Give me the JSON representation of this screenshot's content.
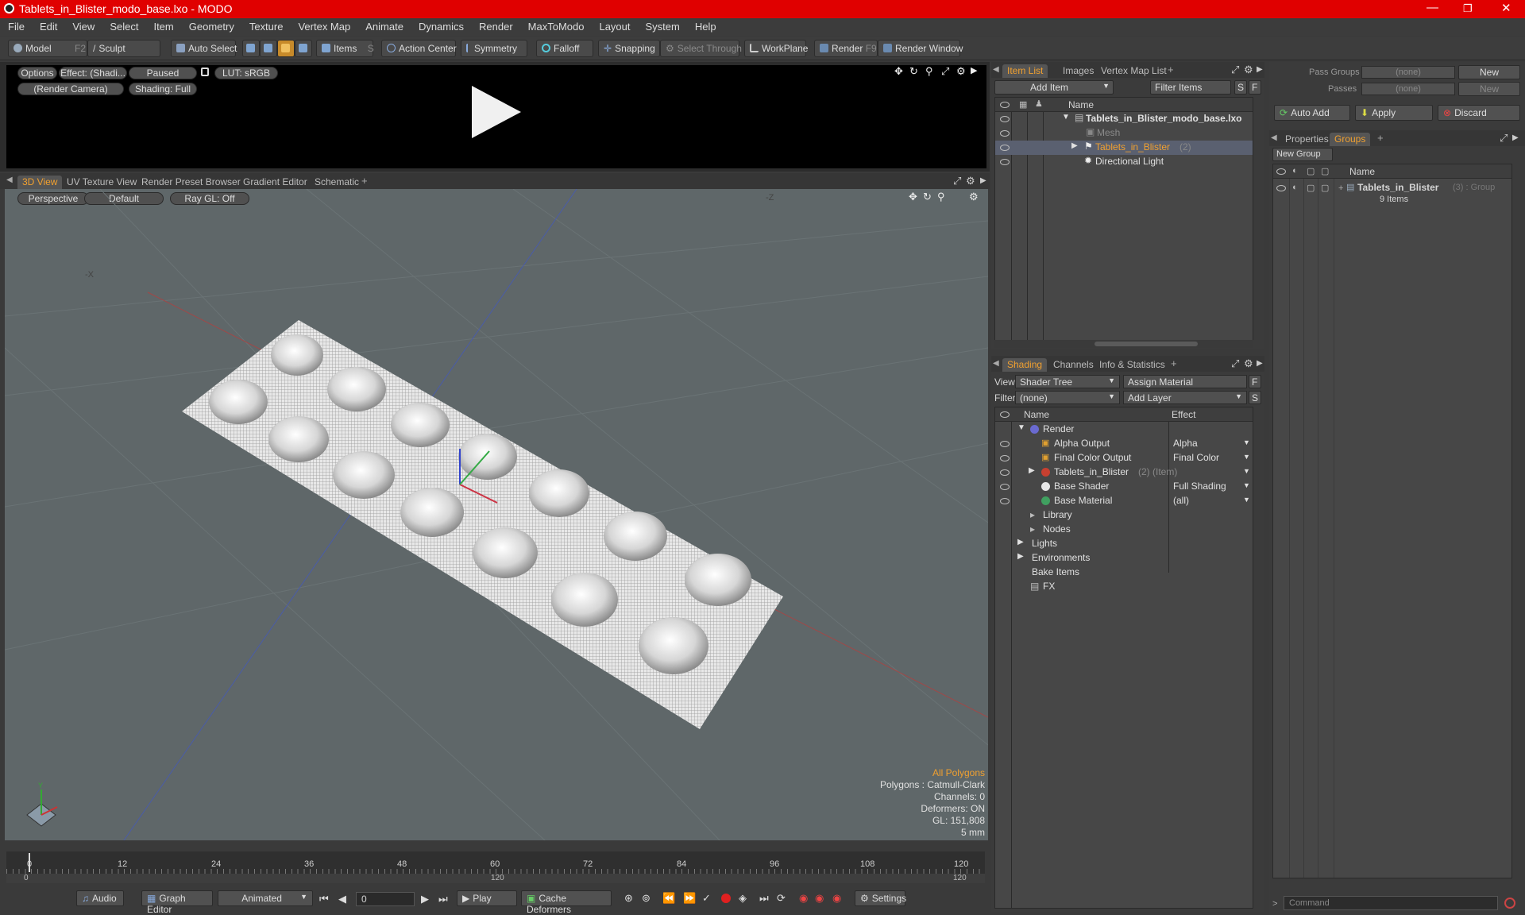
{
  "window": {
    "title": "Tablets_in_Blister_modo_base.lxo - MODO"
  },
  "menu": [
    "File",
    "Edit",
    "View",
    "Select",
    "Item",
    "Geometry",
    "Texture",
    "Vertex Map",
    "Animate",
    "Dynamics",
    "Render",
    "MaxToModo",
    "Layout",
    "System",
    "Help"
  ],
  "toolbar": {
    "model": "Model",
    "model_key": "F2",
    "sculpt": "Sculpt",
    "auto_select": "Auto Select",
    "items": "Items",
    "items_key": "S",
    "action_center": "Action Center",
    "symmetry": "Symmetry",
    "falloff": "Falloff",
    "snapping": "Snapping",
    "select_through": "Select Through",
    "workplane": "WorkPlane",
    "render": "Render",
    "render_key": "F9",
    "render_window": "Render Window"
  },
  "render_preview": {
    "options": "Options",
    "effect": "Effect: (Shadi...",
    "paused": "Paused",
    "lut": "LUT: sRGB",
    "camera": "(Render Camera)",
    "shading": "Shading: Full"
  },
  "viewport_tabs": [
    "3D View",
    "UV Texture View",
    "Render Preset Browser",
    "Gradient Editor",
    "Schematic"
  ],
  "viewport": {
    "perspective": "Perspective",
    "default": "Default",
    "raygl": "Ray GL: Off",
    "axis_x": "-X",
    "axis_z": "-Z",
    "stats": [
      "All Polygons",
      "Polygons : Catmull-Clark",
      "Channels: 0",
      "Deformers: ON",
      "GL: 151,808",
      "5 mm"
    ]
  },
  "timeline": {
    "ticks": [
      "0",
      "12",
      "24",
      "36",
      "48",
      "60",
      "72",
      "84",
      "96",
      "108",
      "120"
    ],
    "range_start": "0",
    "range_mid": "120",
    "range_end": "120"
  },
  "bottom": {
    "audio": "Audio",
    "graph_editor": "Graph Editor",
    "animated": "Animated",
    "frame": "0",
    "play": "Play",
    "cache_deformers": "Cache Deformers",
    "settings": "Settings"
  },
  "item_list": {
    "tabs": [
      "Item List",
      "Images",
      "Vertex Map List"
    ],
    "add_item": "Add Item",
    "filter": "Filter Items",
    "s": "S",
    "f": "F",
    "col_name": "Name",
    "rows": [
      {
        "label": "Tablets_in_Blister_modo_base.lxo",
        "extra": ""
      },
      {
        "label": "Mesh",
        "extra": ""
      },
      {
        "label": "Tablets_in_Blister",
        "extra": "(2)"
      },
      {
        "label": "Directional Light",
        "extra": ""
      }
    ]
  },
  "shading": {
    "tabs": [
      "Shading",
      "Channels",
      "Info & Statistics"
    ],
    "view_label": "View",
    "view_value": "Shader Tree",
    "assign_material": "Assign Material",
    "filter_label": "Filter",
    "filter_value": "(none)",
    "add_layer": "Add Layer",
    "col_name": "Name",
    "col_effect": "Effect",
    "rows": [
      {
        "label": "Render",
        "effect": "",
        "extra": ""
      },
      {
        "label": "Alpha Output",
        "effect": "Alpha",
        "extra": ""
      },
      {
        "label": "Final Color Output",
        "effect": "Final Color",
        "extra": ""
      },
      {
        "label": "Tablets_in_Blister",
        "effect": "",
        "extra": "(2) (Item)"
      },
      {
        "label": "Base Shader",
        "effect": "Full Shading",
        "extra": ""
      },
      {
        "label": "Base Material",
        "effect": "(all)",
        "extra": ""
      },
      {
        "label": "Library",
        "effect": "",
        "extra": ""
      },
      {
        "label": "Nodes",
        "effect": "",
        "extra": ""
      },
      {
        "label": "Lights",
        "effect": "",
        "extra": ""
      },
      {
        "label": "Environments",
        "effect": "",
        "extra": ""
      },
      {
        "label": "Bake Items",
        "effect": "",
        "extra": ""
      },
      {
        "label": "FX",
        "effect": "",
        "extra": ""
      }
    ]
  },
  "groups_panel": {
    "pass_groups": "Pass Groups",
    "passes": "Passes",
    "none": "(none)",
    "new": "New",
    "auto_add": "Auto Add",
    "apply": "Apply",
    "discard": "Discard",
    "tabs": [
      "Properties",
      "Groups"
    ],
    "new_group": "New Group",
    "col_name": "Name",
    "group_name": "Tablets_in_Blister",
    "group_extra": "(3) : Group",
    "group_items": "9 Items"
  },
  "command": {
    "placeholder": "Command"
  },
  "colors": {
    "accent": "#f0a030",
    "titlebar": "#e00000",
    "viewport": "#5f6769"
  }
}
